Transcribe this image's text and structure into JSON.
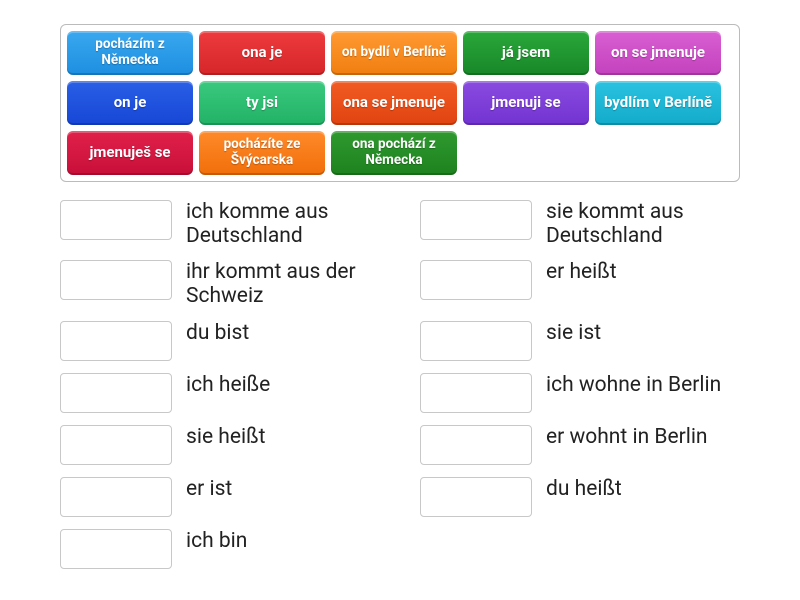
{
  "tiles": [
    {
      "text": "pocházím z Německa",
      "color": "c-sky",
      "small": true
    },
    {
      "text": "ona je",
      "color": "c-red",
      "small": false
    },
    {
      "text": "on bydlí v Berlíně",
      "color": "c-orange",
      "small": true
    },
    {
      "text": "já jsem",
      "color": "c-green",
      "small": false
    },
    {
      "text": "on se jmenuje",
      "color": "c-magenta",
      "small": false
    },
    {
      "text": "on je",
      "color": "c-blue",
      "small": false
    },
    {
      "text": "ty jsi",
      "color": "c-teal",
      "small": false
    },
    {
      "text": "ona se jmenuje",
      "color": "c-dorange",
      "small": false
    },
    {
      "text": "jmenuji se",
      "color": "c-purple",
      "small": false
    },
    {
      "text": "bydlím v Berlíně",
      "color": "c-cyan",
      "small": false
    },
    {
      "text": "jmenuješ se",
      "color": "c-crimson",
      "small": false
    },
    {
      "text": "pocházíte ze Švýcarska",
      "color": "c-amber",
      "small": true
    },
    {
      "text": "ona pochází z Německa",
      "color": "c-dgreen",
      "small": true
    }
  ],
  "targets_left": [
    "ich komme aus Deutschland",
    "ihr kommt aus der Schweiz",
    "du bist",
    "ich heiße",
    "sie heißt",
    "er ist",
    "ich bin"
  ],
  "targets_right": [
    "sie kommt aus Deutschland",
    "er heißt",
    "sie ist",
    "ich wohne in Berlin",
    "er wohnt in Berlin",
    "du heißt"
  ]
}
